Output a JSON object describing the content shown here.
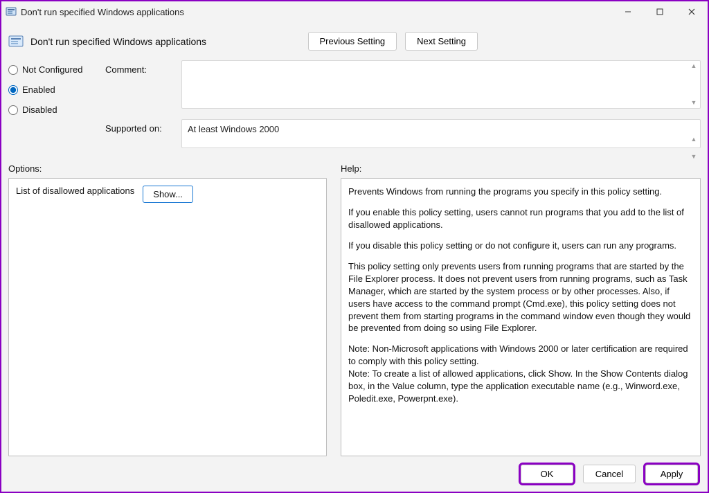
{
  "window": {
    "title": "Don't run specified Windows applications"
  },
  "header": {
    "policy_name": "Don't run specified Windows applications",
    "prev": "Previous Setting",
    "next": "Next Setting"
  },
  "state": {
    "options": {
      "not_configured": "Not Configured",
      "enabled": "Enabled",
      "disabled": "Disabled"
    },
    "selected": "enabled"
  },
  "labels": {
    "comment": "Comment:",
    "supported": "Supported on:",
    "options": "Options:",
    "help": "Help:"
  },
  "supported_on": "At least Windows 2000",
  "options_panel": {
    "list_label": "List of disallowed applications",
    "show": "Show..."
  },
  "help_text": {
    "p1": "Prevents Windows from running the programs you specify in this policy setting.",
    "p2": "If you enable this policy setting, users cannot run programs that you add to the list of disallowed applications.",
    "p3": "If you disable this policy setting or do not configure it, users can run any programs.",
    "p4": "This policy setting only prevents users from running programs that are started by the File Explorer process. It does not prevent users from running programs, such as Task Manager, which are started by the system process or by other processes.  Also, if users have access to the command prompt (Cmd.exe), this policy setting does not prevent them from starting programs in the command window even though they would be prevented from doing so using File Explorer.",
    "p5": "Note: Non-Microsoft applications with Windows 2000 or later certification are required to comply with this policy setting.",
    "p6": "Note: To create a list of allowed applications, click Show.  In the Show Contents dialog box, in the Value column, type the application executable name (e.g., Winword.exe, Poledit.exe, Powerpnt.exe)."
  },
  "footer": {
    "ok": "OK",
    "cancel": "Cancel",
    "apply": "Apply"
  }
}
